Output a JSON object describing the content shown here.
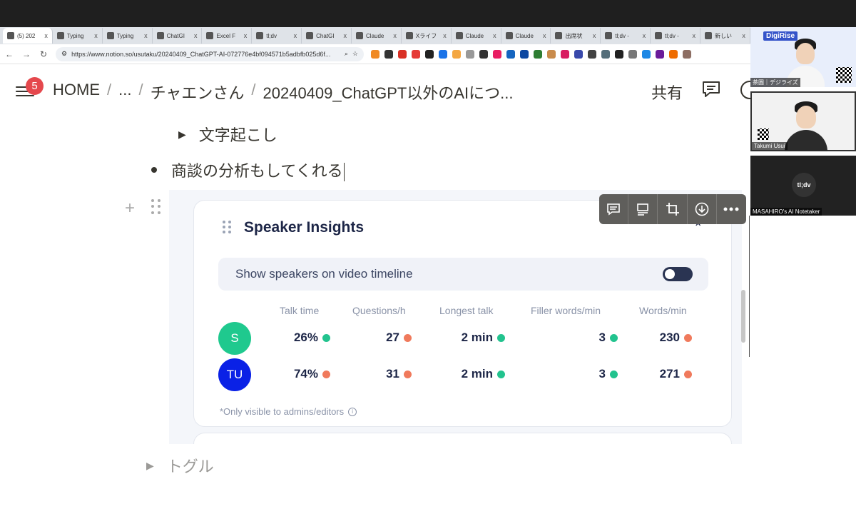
{
  "browser": {
    "tabs": [
      {
        "title": "(5) 202",
        "active": true
      },
      {
        "title": "Typing"
      },
      {
        "title": "Typing"
      },
      {
        "title": "ChatGI"
      },
      {
        "title": "Excel F"
      },
      {
        "title": "tl;dv"
      },
      {
        "title": "ChatGI"
      },
      {
        "title": "Claude"
      },
      {
        "title": "Xライフ"
      },
      {
        "title": "Claude"
      },
      {
        "title": "Claude"
      },
      {
        "title": "出席状"
      },
      {
        "title": "tl;dv -"
      },
      {
        "title": "tl;dv -"
      },
      {
        "title": "新しい"
      }
    ],
    "url": "https://www.notion.so/usutaku/20240409_ChatGPT-AI-072776e4bf094571b5adbfb025d6f...",
    "close_glyph": "x"
  },
  "notion": {
    "notification_count": "5",
    "breadcrumb": [
      "HOME",
      "...",
      "チャエンさん",
      "20240409_ChatGPT以外のAIにつ..."
    ],
    "breadcrumb_sep": "/",
    "share_label": "共有",
    "toggle_1": "文字起こし",
    "bullet_text": "商談の分析もしてくれる",
    "toggle_2": "トグル"
  },
  "speaker_insights": {
    "title": "Speaker Insights",
    "toggle_label": "Show speakers on video timeline",
    "toggle_on": false,
    "columns": [
      "Talk time",
      "Questions/h",
      "Longest talk",
      "Filler words/min",
      "Words/min"
    ],
    "rows": [
      {
        "initials": "S",
        "avatar_color": "#1fc98e",
        "values": [
          "26%",
          "27",
          "2 min",
          "3",
          "230"
        ],
        "status": [
          "green",
          "red",
          "green",
          "green",
          "red"
        ]
      },
      {
        "initials": "TU",
        "avatar_color": "#0a21e6",
        "values": [
          "74%",
          "31",
          "2 min",
          "3",
          "271"
        ],
        "status": [
          "red",
          "red",
          "green",
          "green",
          "red"
        ]
      }
    ],
    "footnote": "*Only visible to admins/editors",
    "status_colors": {
      "green": "#22c38e",
      "red": "#f07a5c"
    }
  },
  "video_panel": {
    "tile1_brand": "DigiRise",
    "tile1_label": "茶圓｜デジライズ",
    "tile2_label": "Takumi Usui",
    "tile3_logo": "tl;dv",
    "tile3_label": "MASAHIRO's AI Notetaker"
  }
}
